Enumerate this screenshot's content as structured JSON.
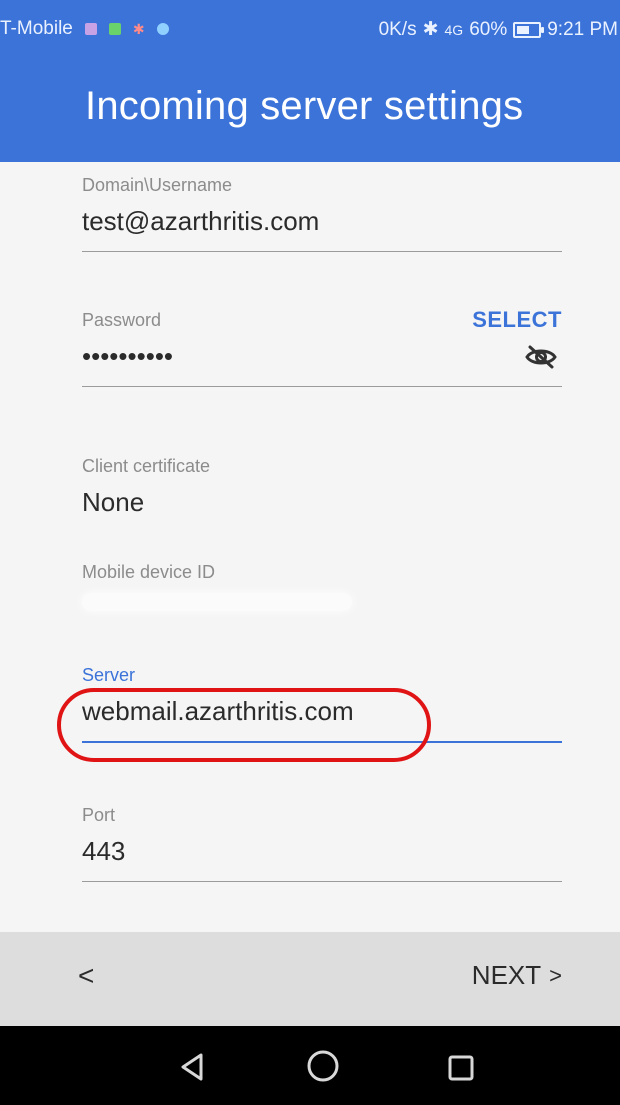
{
  "status_bar": {
    "carrier": "T-Mobile",
    "network_speed": "0K/s",
    "signal_label": "4G",
    "battery_percent_text": "60%",
    "battery_level_percent": 60,
    "time": "9:21 PM"
  },
  "header": {
    "title": "Incoming server settings"
  },
  "fields": {
    "domain_username": {
      "label": "Domain\\Username",
      "value": "test@azarthritis.com"
    },
    "password": {
      "label": "Password",
      "value": "••••••••••"
    },
    "client_certificate": {
      "label": "Client certificate",
      "value": "None",
      "action_label": "SELECT"
    },
    "mobile_device_id": {
      "label": "Mobile device ID"
    },
    "server": {
      "label": "Server",
      "value": "webmail.azarthritis.com"
    },
    "port": {
      "label": "Port",
      "value": "443"
    }
  },
  "bottom_bar": {
    "back_label": "<",
    "next_label": "NEXT",
    "next_chevron": ">"
  },
  "colors": {
    "accent": "#3b73d9",
    "highlight": "#e01414"
  },
  "icons": {
    "password_visibility": "eye-off-icon",
    "nav_back": "nav-back-icon",
    "nav_home": "nav-home-icon",
    "nav_recent": "nav-recent-apps-icon"
  }
}
